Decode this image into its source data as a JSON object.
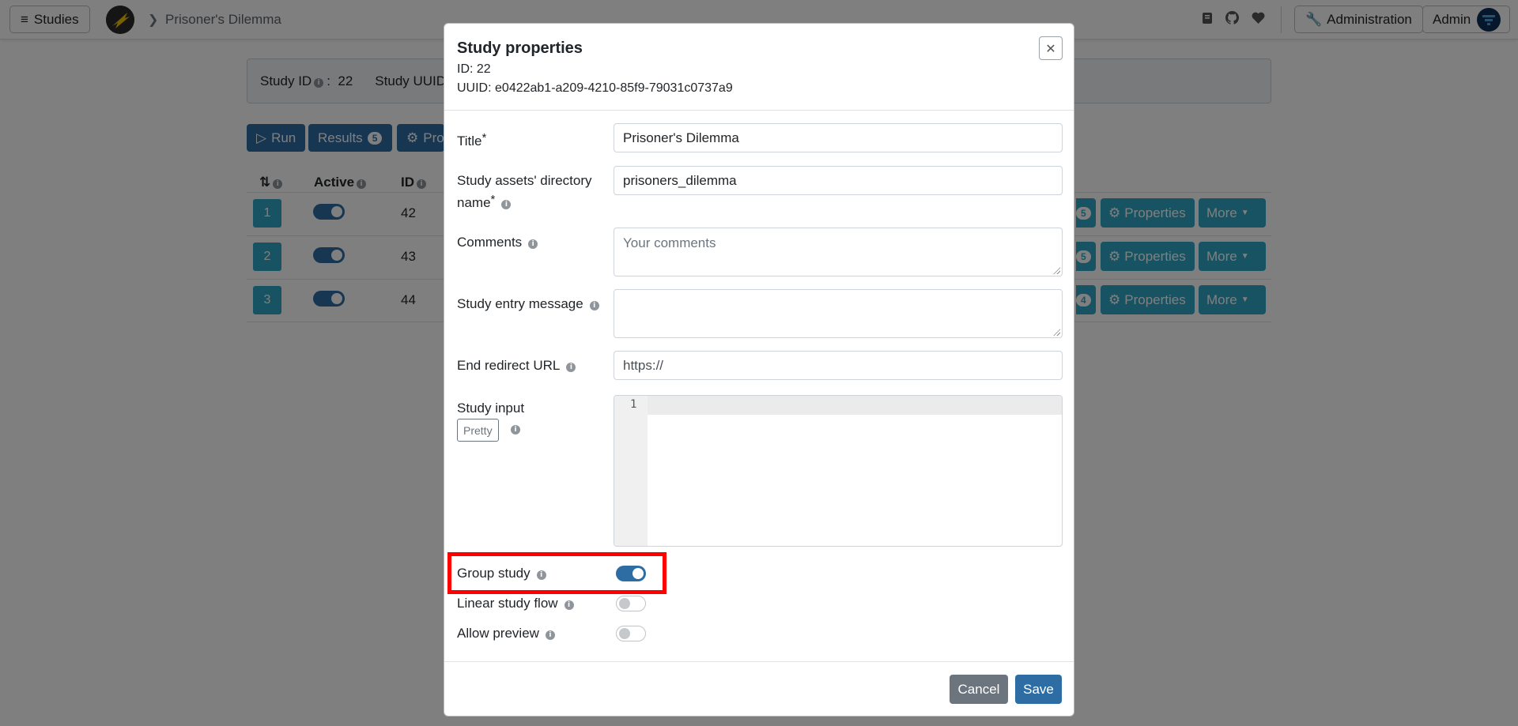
{
  "topbar": {
    "studies_label": "Studies",
    "breadcrumb": "Prisoner's Dilemma",
    "admin_label": "Administration",
    "user_label": "Admin"
  },
  "study_info": {
    "id_label": "Study ID",
    "id_value": "22",
    "uuid_label": "Study UUID"
  },
  "toolbar": {
    "run_label": "Run",
    "results_label": "Results",
    "results_count": "5",
    "properties_label": "Pro"
  },
  "table": {
    "headers": {
      "position": "⇅",
      "active": "Active",
      "id": "ID"
    },
    "rows": [
      {
        "position": "1",
        "id": "42",
        "count": "5",
        "properties": "Properties",
        "more": "More"
      },
      {
        "position": "2",
        "id": "43",
        "count": "5",
        "properties": "Properties",
        "more": "More"
      },
      {
        "position": "3",
        "id": "44",
        "count": "4",
        "properties": "Properties",
        "more": "More"
      }
    ]
  },
  "modal": {
    "title": "Study properties",
    "id_line_label": "ID:",
    "id_line_value": "22",
    "uuid_line_label": "UUID:",
    "uuid_line_value": "e0422ab1-a209-4210-85f9-79031c0737a9",
    "fields": {
      "title_label": "Title",
      "title_value": "Prisoner's Dilemma",
      "dir_label_1": "Study assets' directory",
      "dir_label_2": "name",
      "dir_value": "prisoners_dilemma",
      "comments_label": "Comments",
      "comments_placeholder": "Your comments",
      "entry_msg_label": "Study entry message",
      "entry_msg_value": "",
      "end_url_label": "End redirect URL",
      "end_url_placeholder": "https://",
      "study_input_label": "Study input",
      "pretty_label": "Pretty",
      "editor_line": "1"
    },
    "toggles": [
      {
        "label": "Group study",
        "on": true
      },
      {
        "label": "Linear study flow",
        "on": false
      },
      {
        "label": "Allow preview",
        "on": false
      }
    ],
    "cancel_label": "Cancel",
    "save_label": "Save"
  },
  "colors": {
    "primary": "#2e6da4",
    "info": "#2ea7c6",
    "secondary": "#6c757d",
    "highlight": "#ff0000"
  }
}
